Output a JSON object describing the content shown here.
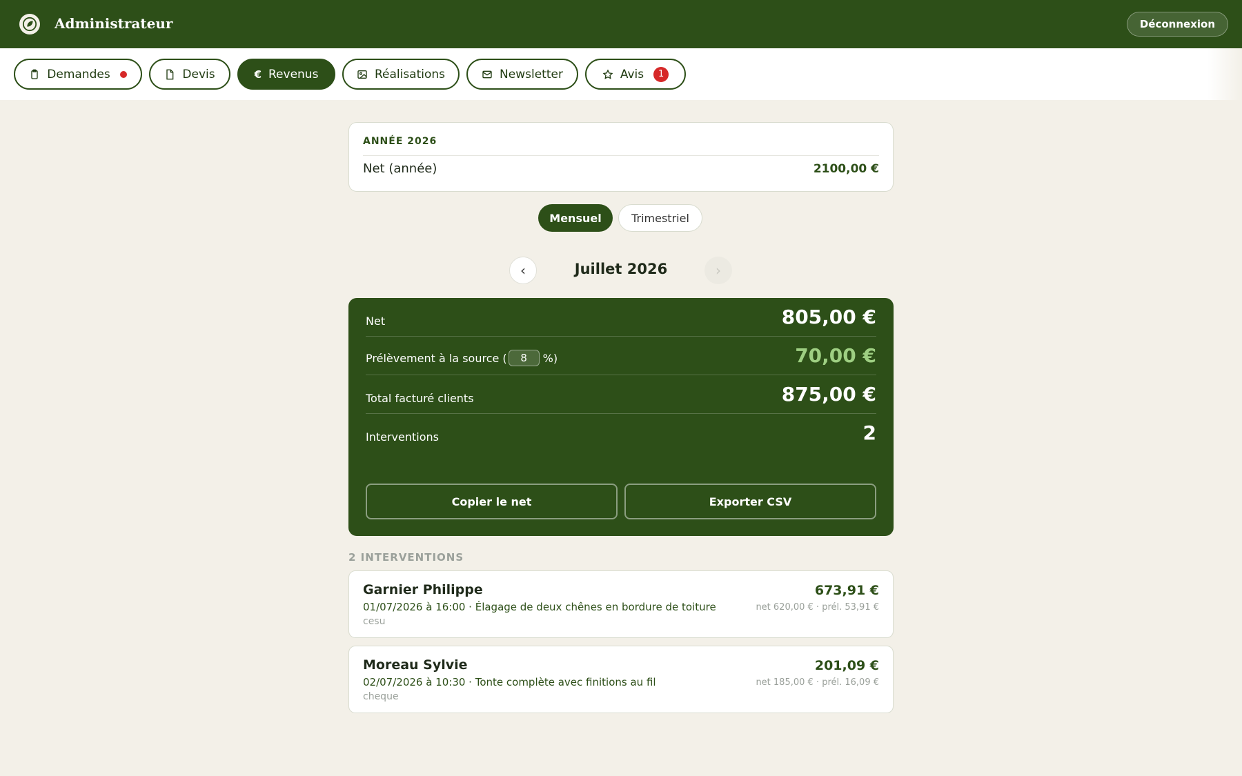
{
  "app": {
    "title": "Administrateur",
    "logout_label": "Déconnexion"
  },
  "tabs": [
    {
      "label": "Demandes",
      "icon": "clipboard-icon",
      "indicator": "dot"
    },
    {
      "label": "Devis",
      "icon": "document-icon"
    },
    {
      "label": "Revenus",
      "icon": "euro-icon",
      "icon_glyph": "€",
      "active": true
    },
    {
      "label": "Réalisations",
      "icon": "image-icon"
    },
    {
      "label": "Newsletter",
      "icon": "mail-icon"
    },
    {
      "label": "Avis",
      "icon": "star-icon",
      "badge": "1"
    }
  ],
  "year_summary": {
    "title": "ANNÉE 2026",
    "net_label": "Net (année)",
    "net_value": "2100,00 €"
  },
  "period_toggle": {
    "options": [
      "Mensuel",
      "Trimestriel"
    ],
    "selected": "Mensuel"
  },
  "month_nav": {
    "prev_glyph": "‹",
    "next_glyph": "›",
    "current": "Juillet 2026"
  },
  "summary": {
    "net_label": "Net",
    "net_value": "805,00 €",
    "withholding_label": "Prélèvement à la source (",
    "withholding_rate": "8",
    "withholding_suffix": "%)",
    "withholding_value": "70,00 €",
    "total_label": "Total facturé clients",
    "total_value": "875,00 €",
    "interventions_label": "Interventions",
    "interventions_value": "2",
    "copy_button": "Copier le net",
    "export_button": "Exporter CSV"
  },
  "interventions": {
    "header": "2 INTERVENTIONS",
    "items": [
      {
        "client": "Garnier Philippe",
        "description": "01/07/2026 à 16:00 · Élagage de deux chênes en bordure de toiture",
        "payment": "cesu",
        "amount": "673,91 €",
        "detail": "net 620,00 € · prél. 53,91 €"
      },
      {
        "client": "Moreau Sylvie",
        "description": "02/07/2026 à 10:30 · Tonte complète avec finitions au fil",
        "payment": "cheque",
        "amount": "201,09 €",
        "detail": "net 185,00 € · prél. 16,09 €"
      }
    ]
  },
  "colors": {
    "primary": "#2d4f18",
    "background": "#f3f0e8",
    "alert": "#d62828",
    "accent_light": "#9ecf82"
  }
}
